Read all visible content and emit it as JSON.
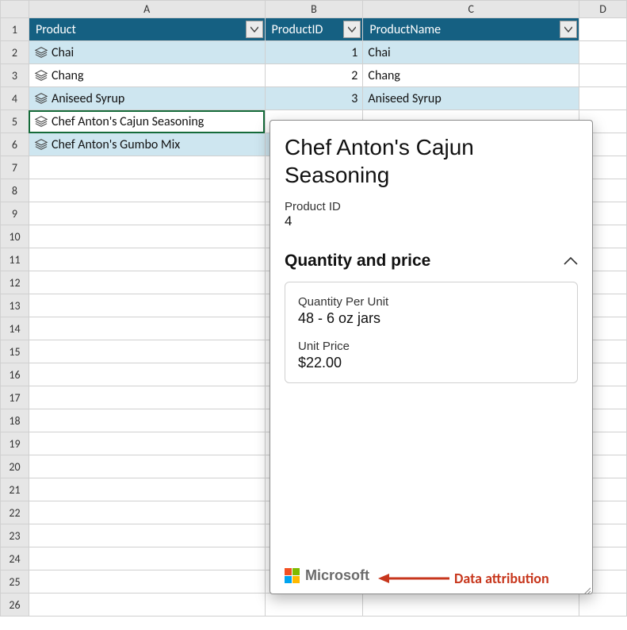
{
  "columns": {
    "A": "A",
    "B": "B",
    "C": "C",
    "D": "D"
  },
  "row_labels": [
    "1",
    "2",
    "3",
    "4",
    "5",
    "6",
    "7",
    "8",
    "9",
    "10",
    "11",
    "12",
    "13",
    "14",
    "15",
    "16",
    "17",
    "18",
    "19",
    "20",
    "21",
    "22",
    "23",
    "24",
    "25",
    "26"
  ],
  "headers": {
    "product": "Product",
    "product_id": "ProductID",
    "product_name": "ProductName"
  },
  "rows": [
    {
      "product": "Chai",
      "id": "1",
      "name": "Chai",
      "banded": true
    },
    {
      "product": "Chang",
      "id": "2",
      "name": "Chang",
      "banded": false
    },
    {
      "product": "Aniseed Syrup",
      "id": "3",
      "name": "Aniseed Syrup",
      "banded": true
    },
    {
      "product": "Chef Anton's Cajun Seasoning",
      "id": "",
      "name": "",
      "banded": false,
      "selected": true
    },
    {
      "product": "Chef Anton's Gumbo Mix",
      "id": "",
      "name": "",
      "banded": true
    }
  ],
  "card": {
    "title": "Chef Anton's Cajun Seasoning",
    "product_id_label": "Product ID",
    "product_id_value": "4",
    "section_title": "Quantity and price",
    "qpu_label": "Quantity Per Unit",
    "qpu_value": "48 - 6 oz jars",
    "price_label": "Unit Price",
    "price_value": "$22.00",
    "attribution": "Microsoft"
  },
  "annotation": "Data attribution"
}
